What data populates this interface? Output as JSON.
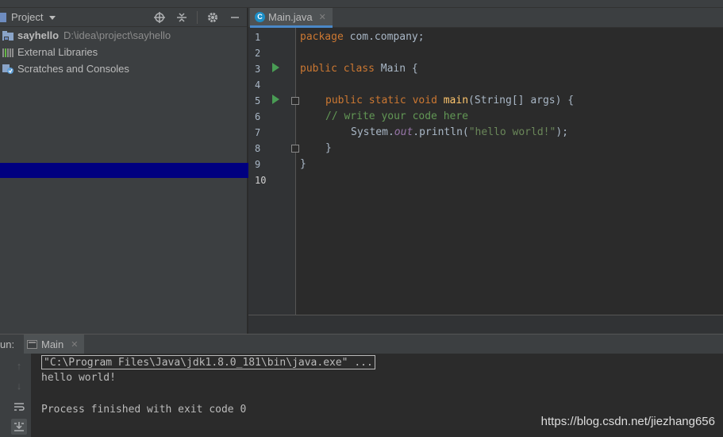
{
  "project_panel": {
    "title": "Project",
    "tree": [
      {
        "label": "sayhello",
        "path": "D:\\idea\\project\\sayhello"
      },
      {
        "label": "External Libraries"
      },
      {
        "label": "Scratches and Consoles"
      }
    ]
  },
  "editor": {
    "tab": {
      "label": "Main.java"
    },
    "line_numbers": [
      "1",
      "2",
      "3",
      "4",
      "5",
      "6",
      "7",
      "8",
      "9",
      "10"
    ],
    "code": {
      "l1_kw": "package",
      "l1_rest": " com.company;",
      "l3_kw1": "public",
      "l3_kw2": "class",
      "l3_rest": " Main {",
      "l5_kw1": "public",
      "l5_kw2": "static",
      "l5_kw3": "void",
      "l5_fn": "main",
      "l5_rest": "(String[] args) {",
      "l6_comment": "// write your code here",
      "l7_pre": "System.",
      "l7_field": "out",
      "l7_mid": ".println(",
      "l7_str": "\"hello world!\"",
      "l7_end": ");",
      "l8": "}",
      "l9": "}"
    }
  },
  "run_panel": {
    "label": "un:",
    "tab": "Main",
    "console": {
      "command": "\"C:\\Program Files\\Java\\jdk1.8.0_181\\bin\\java.exe\" ...",
      "output": "hello world!",
      "exit": "Process finished with exit code 0"
    }
  },
  "watermark": "https://blog.csdn.net/jiezhang656",
  "colors": {
    "keyword": "#cc7832",
    "function": "#ffc66d",
    "comment": "#629755",
    "string": "#6a8759",
    "field": "#9876aa",
    "current_line": "#000080"
  }
}
